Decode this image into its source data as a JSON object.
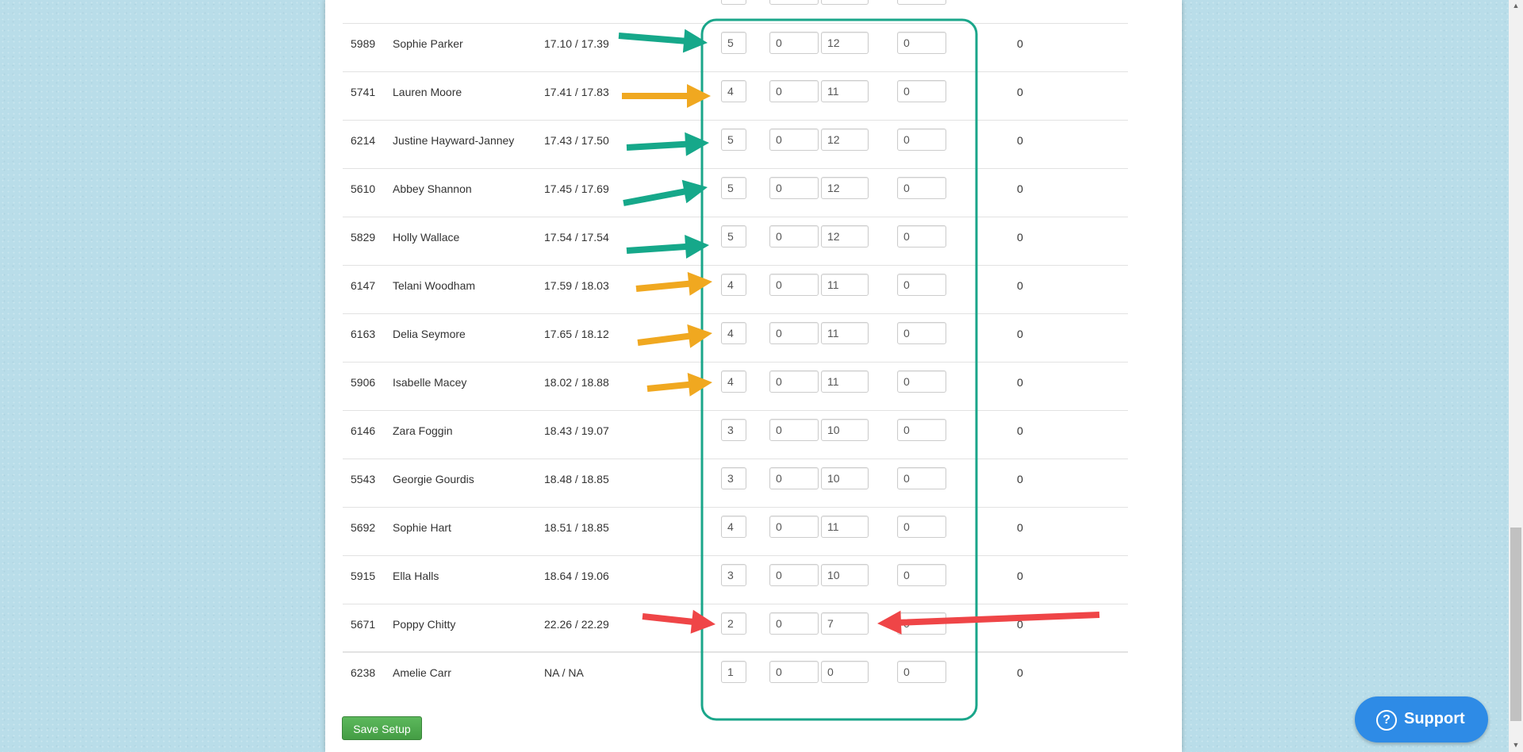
{
  "table": {
    "rows": [
      {
        "id": "5989",
        "name": "Sophie Parker",
        "times": "17.10 / 17.39",
        "v1": "5",
        "v2": "0",
        "v3": "12",
        "v4": "0",
        "points": "0"
      },
      {
        "id": "5741",
        "name": "Lauren Moore",
        "times": "17.41 / 17.83",
        "v1": "4",
        "v2": "0",
        "v3": "11",
        "v4": "0",
        "points": "0"
      },
      {
        "id": "6214",
        "name": "Justine Hayward-Janney",
        "times": "17.43 / 17.50",
        "v1": "5",
        "v2": "0",
        "v3": "12",
        "v4": "0",
        "points": "0"
      },
      {
        "id": "5610",
        "name": "Abbey Shannon",
        "times": "17.45 / 17.69",
        "v1": "5",
        "v2": "0",
        "v3": "12",
        "v4": "0",
        "points": "0"
      },
      {
        "id": "5829",
        "name": "Holly Wallace",
        "times": "17.54 / 17.54",
        "v1": "5",
        "v2": "0",
        "v3": "12",
        "v4": "0",
        "points": "0"
      },
      {
        "id": "6147",
        "name": "Telani Woodham",
        "times": "17.59 / 18.03",
        "v1": "4",
        "v2": "0",
        "v3": "11",
        "v4": "0",
        "points": "0"
      },
      {
        "id": "6163",
        "name": "Delia Seymore",
        "times": "17.65 / 18.12",
        "v1": "4",
        "v2": "0",
        "v3": "11",
        "v4": "0",
        "points": "0"
      },
      {
        "id": "5906",
        "name": "Isabelle Macey",
        "times": "18.02 / 18.88",
        "v1": "4",
        "v2": "0",
        "v3": "11",
        "v4": "0",
        "points": "0"
      },
      {
        "id": "6146",
        "name": "Zara Foggin",
        "times": "18.43 / 19.07",
        "v1": "3",
        "v2": "0",
        "v3": "10",
        "v4": "0",
        "points": "0"
      },
      {
        "id": "5543",
        "name": "Georgie Gourdis",
        "times": "18.48 / 18.85",
        "v1": "3",
        "v2": "0",
        "v3": "10",
        "v4": "0",
        "points": "0"
      },
      {
        "id": "5692",
        "name": "Sophie Hart",
        "times": "18.51 / 18.85",
        "v1": "4",
        "v2": "0",
        "v3": "11",
        "v4": "0",
        "points": "0"
      },
      {
        "id": "5915",
        "name": "Ella Halls",
        "times": "18.64 / 19.06",
        "v1": "3",
        "v2": "0",
        "v3": "10",
        "v4": "0",
        "points": "0"
      },
      {
        "id": "5671",
        "name": "Poppy Chitty",
        "times": "22.26 / 22.29",
        "v1": "2",
        "v2": "0",
        "v3": "7",
        "v4": "0",
        "points": "0"
      },
      {
        "id": "6238",
        "name": "Amelie Carr",
        "times": "NA / NA",
        "v1": "1",
        "v2": "0",
        "v3": "0",
        "v4": "0",
        "points": "0"
      }
    ]
  },
  "actions": {
    "save_label": "Save Setup",
    "support_label": "Support",
    "support_icon": "question-circle-icon"
  },
  "annotations": {
    "highlight_color": "#1aa68a",
    "arrow_colors": {
      "green": "#16a88a",
      "orange": "#f0a820",
      "red": "#ef4547"
    }
  }
}
